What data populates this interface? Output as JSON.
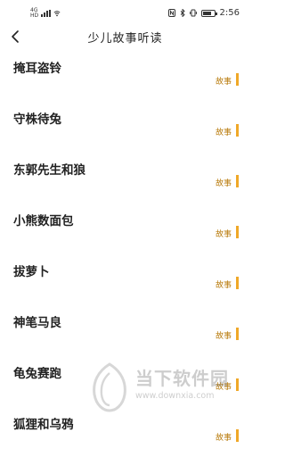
{
  "status_bar": {
    "network_labels": [
      "4G",
      "HD"
    ],
    "battery_percent": 80,
    "time": "2:56"
  },
  "header": {
    "back_icon": "chevron-left-icon",
    "title": "少儿故事听读"
  },
  "stories": [
    {
      "title": "掩耳盗铃",
      "tag": "故事"
    },
    {
      "title": "守株待兔",
      "tag": "故事"
    },
    {
      "title": "东郭先生和狼",
      "tag": "故事"
    },
    {
      "title": "小熊数面包",
      "tag": "故事"
    },
    {
      "title": "拔萝卜",
      "tag": "故事"
    },
    {
      "title": "神笔马良",
      "tag": "故事"
    },
    {
      "title": "龟兔赛跑",
      "tag": "故事"
    },
    {
      "title": "狐狸和乌鸦",
      "tag": "故事"
    }
  ],
  "watermark": {
    "name": "当下软件园",
    "url": "www.downxia.com"
  },
  "colors": {
    "accent": "#f0a828",
    "tag_text": "#b87a0a"
  }
}
